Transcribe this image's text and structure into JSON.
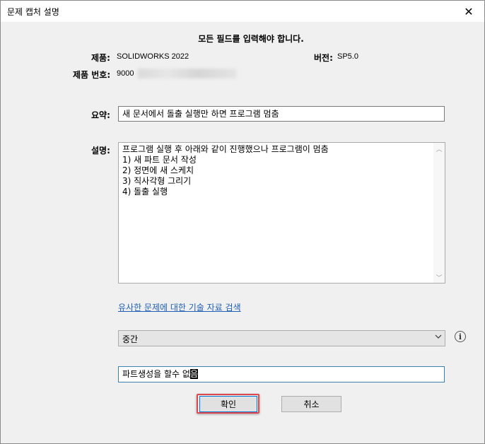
{
  "dialog": {
    "title": "문제 캡처 설명",
    "close_glyph": "✕"
  },
  "required_message": "모든 필드를 입력해야 합니다.",
  "product": {
    "label": "제품:",
    "value": "SOLIDWORKS 2022"
  },
  "version": {
    "label": "버전:",
    "value": "SP5.0"
  },
  "product_number": {
    "label": "제품 번호:",
    "value": "9000"
  },
  "summary": {
    "label": "요약:",
    "value": "새 문서에서 돌출 실행만 하면 프로그램 멈춤"
  },
  "description": {
    "label": "설명:",
    "lines": [
      "프로그램 실행 후 아래와 같이 진행했으나 프로그램이 멈춤",
      "1) 새 파트 문서 작성",
      "2) 정면에 새 스케치",
      "3) 직사각형 그리기",
      "4) 돌출 실행"
    ]
  },
  "search_link": "유사한 문제에 대한 기술 자료 검색",
  "severity": {
    "selected": "중간"
  },
  "info_glyph": "i",
  "extra_input": {
    "value": "파트생성을 할수 없",
    "caret_char": "음"
  },
  "buttons": {
    "ok": "확인",
    "cancel": "취소"
  },
  "colors": {
    "accent": "#0078d7",
    "highlight": "#e0474c",
    "link": "#1f5fb3"
  }
}
